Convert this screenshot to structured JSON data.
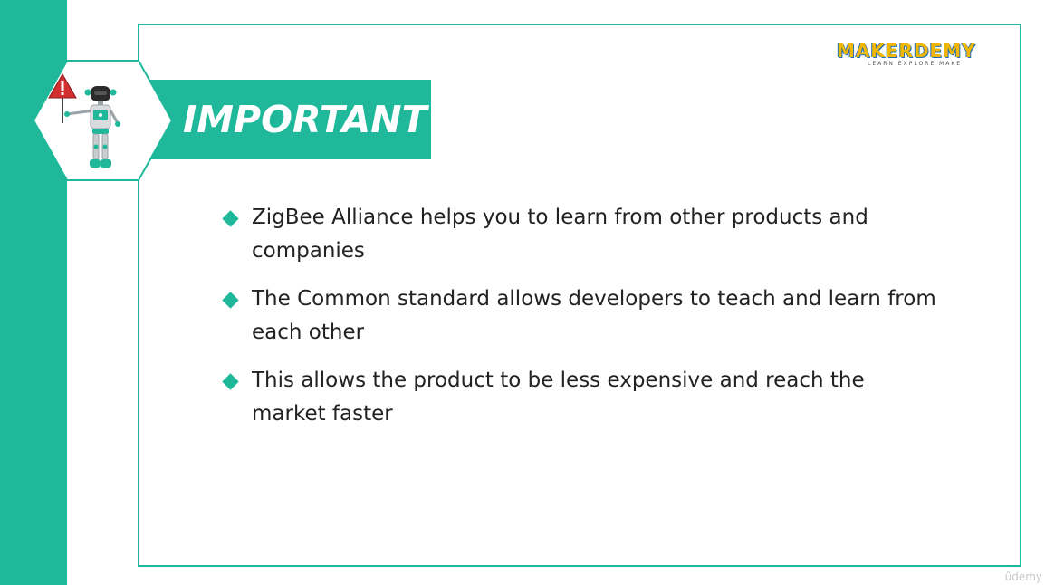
{
  "slide": {
    "title": "IMPORTANT",
    "bullets": [
      "ZigBee Alliance helps you to learn from other products and companies",
      "The Common standard allows developers to teach and learn from each other",
      "This allows the product to be less expensive and reach the market faster"
    ]
  },
  "logo": {
    "name": "MAKERDEMY",
    "tagline": "LEARN EXPLORE MAKE"
  },
  "watermark": "ûdemy",
  "icons": {
    "warning": "warning-icon",
    "robot": "robot-icon",
    "bullet": "diamond-bullet-icon"
  },
  "colors": {
    "accent": "#1fb89a",
    "text": "#222222",
    "logo_primary": "#f2b705",
    "logo_secondary": "#1e6fb8",
    "warning": "#d32f2f"
  }
}
